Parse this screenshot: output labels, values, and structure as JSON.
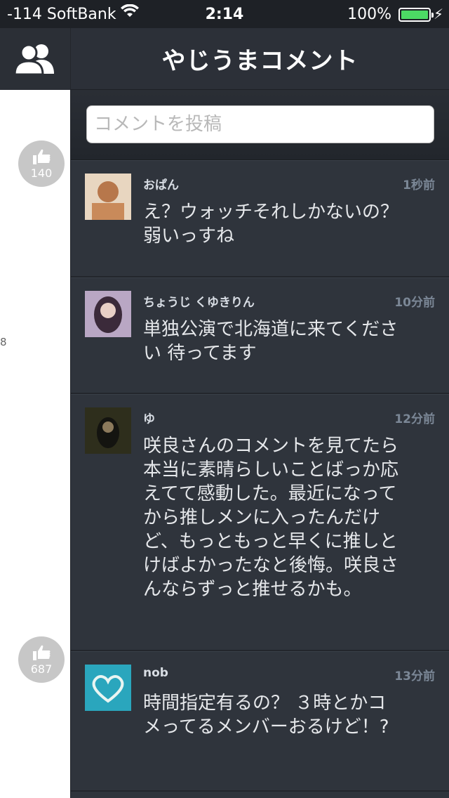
{
  "status_bar": {
    "carrier": "-114 SoftBank",
    "time": "2:14",
    "battery": "100%"
  },
  "left_panel": {
    "likes": [
      {
        "count": "140"
      },
      {
        "count": "687"
      }
    ],
    "stray_text": "8"
  },
  "header": {
    "title": "やじうまコメント"
  },
  "comment_input": {
    "placeholder": "コメントを投稿"
  },
  "comments": [
    {
      "name": "おぱん",
      "time": "1秒前",
      "text": "え？ウォッチそれしかないの？ 弱いっすね",
      "avatar_color": "#c98a5a"
    },
    {
      "name": "ちょうじ くゆきりん",
      "time": "10分前",
      "text": "単独公演で北海道に来てください 待ってます",
      "avatar_color": "#8a6fa0"
    },
    {
      "name": "ゆ",
      "time": "12分前",
      "text": "咲良さんのコメントを見てたら本当に素晴らしいことばっか応えてて感動した。最近になってから推しメンに入ったんだけど、もっともっと早くに推しとけばよかったなと後悔。咲良さんならずっと推せるかも。",
      "avatar_color": "#3a3a22"
    },
    {
      "name": "nob",
      "time": "13分前",
      "text": "時間指定有るの？ ３時とかコメってるメンバーおるけど！?",
      "avatar_color": "#38b6c8"
    }
  ],
  "colors": {
    "panel_bg": "#2f343c",
    "header_bg": "#2c3038",
    "time_text": "#7b8796",
    "battery_green": "#4cd964"
  }
}
